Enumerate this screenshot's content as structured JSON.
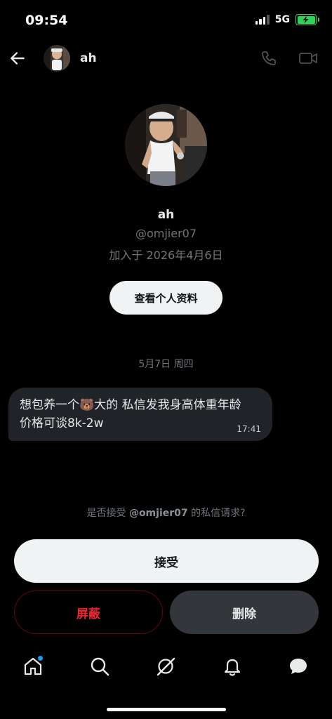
{
  "status_bar": {
    "time": "09:54",
    "network": "5G"
  },
  "header": {
    "name": "ah"
  },
  "profile": {
    "name": "ah",
    "handle": "@omjier07",
    "joined": "加入于 2026年4月6日",
    "view_profile_label": "查看个人资料"
  },
  "conversation": {
    "date": "5月7日 周四",
    "message": {
      "text": "想包养一个🐻大的 私信发我身高体重年龄 价格可谈8k-2w",
      "time": "17:41"
    }
  },
  "request": {
    "prefix": "是否接受 ",
    "handle": "@omjier07",
    "suffix": " 的私信请求?",
    "accept_label": "接受",
    "block_label": "屏蔽",
    "delete_label": "删除"
  },
  "icons": {
    "back": "arrow-left-icon",
    "call": "phone-icon",
    "video": "video-camera-icon",
    "nav": [
      "home-icon",
      "search-icon",
      "grok-icon",
      "bell-icon",
      "messages-icon"
    ]
  },
  "colors": {
    "background": "#000000",
    "bubble": "#202327",
    "accent": "#1d9bf0",
    "danger": "#f4212e",
    "battery": "#30d158"
  }
}
